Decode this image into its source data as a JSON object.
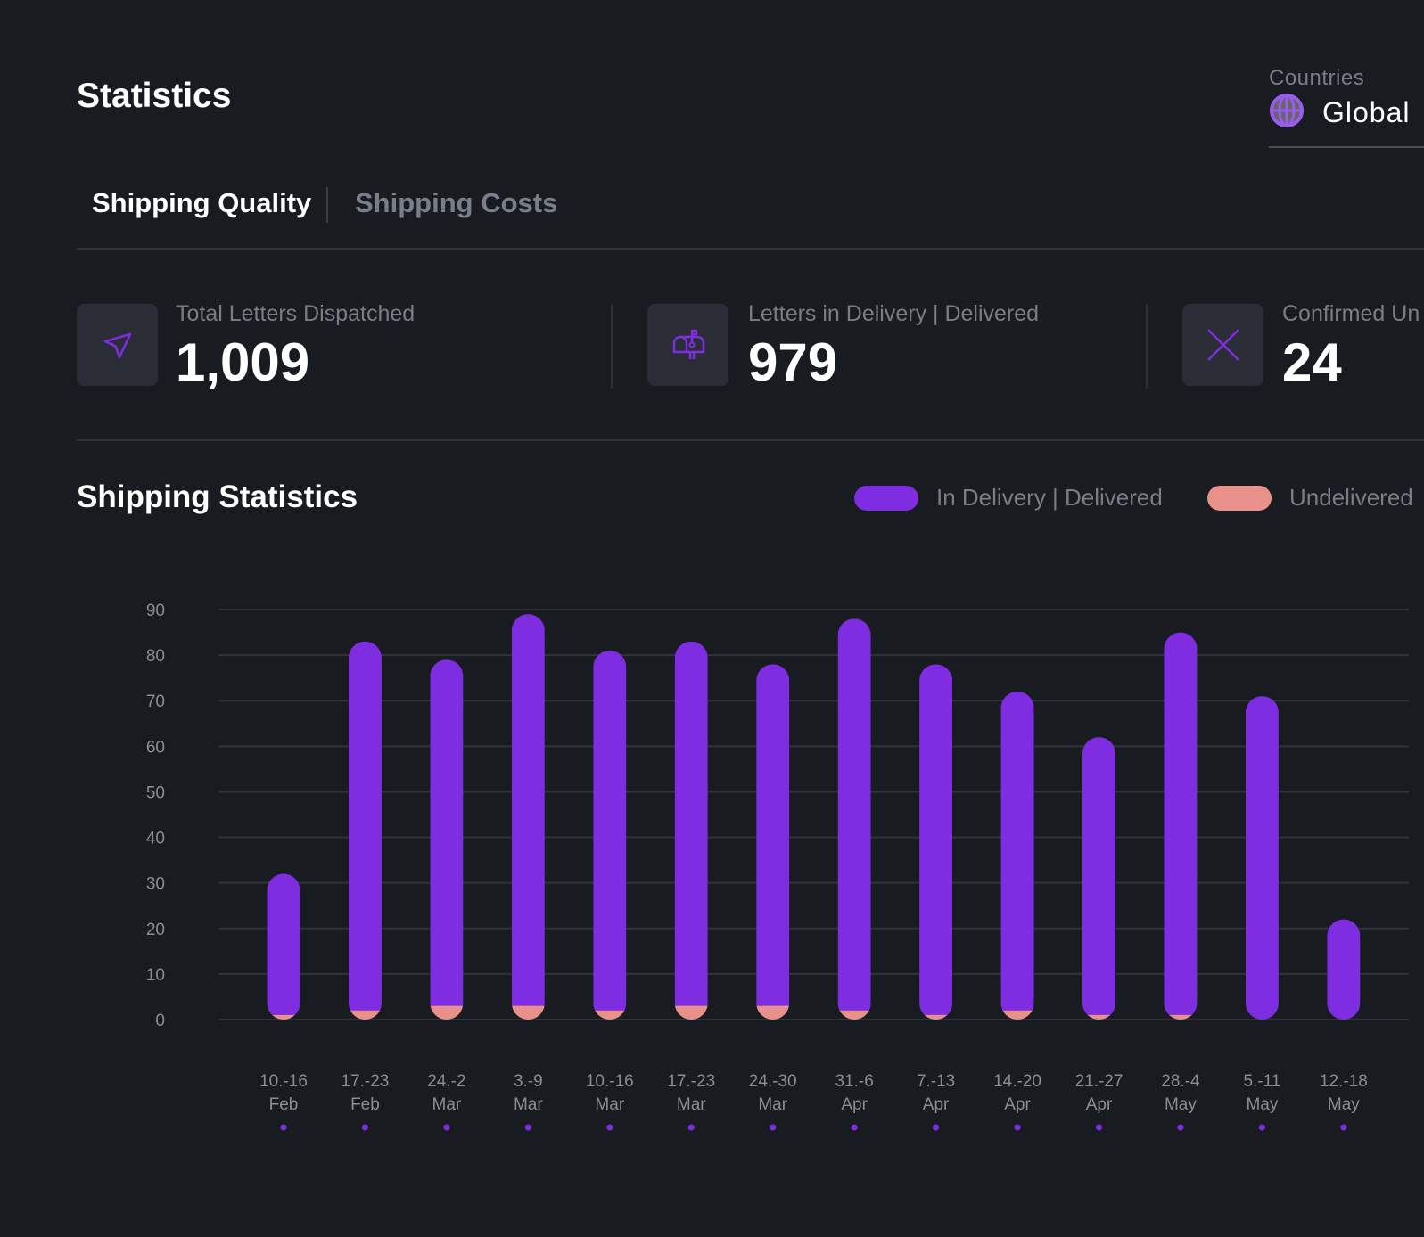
{
  "header": {
    "title": "Statistics"
  },
  "country_selector": {
    "label": "Countries",
    "value": "Global",
    "icon": "globe-icon"
  },
  "tabs": [
    {
      "label": "Shipping Quality",
      "active": true
    },
    {
      "label": "Shipping Costs",
      "active": false
    }
  ],
  "stats": [
    {
      "label": "Total Letters Dispatched",
      "value": "1,009",
      "icon": "paper-plane-icon"
    },
    {
      "label": "Letters in Delivery | Delivered",
      "value": "979",
      "icon": "mailbox-icon"
    },
    {
      "label": "Confirmed Un",
      "value": "24",
      "icon": "close-x-icon"
    }
  ],
  "section_title": "Shipping Statistics",
  "colors": {
    "accent": "#7e2de0",
    "undelivered": "#e8908a",
    "background": "#181b20"
  },
  "chart_data": {
    "type": "bar",
    "stacked": true,
    "categories": [
      [
        "10.-16",
        "Feb"
      ],
      [
        "17.-23",
        "Feb"
      ],
      [
        "24.-2",
        "Mar"
      ],
      [
        "3.-9",
        "Mar"
      ],
      [
        "10.-16",
        "Mar"
      ],
      [
        "17.-23",
        "Mar"
      ],
      [
        "24.-30",
        "Mar"
      ],
      [
        "31.-6",
        "Apr"
      ],
      [
        "7.-13",
        "Apr"
      ],
      [
        "14.-20",
        "Apr"
      ],
      [
        "21.-27",
        "Apr"
      ],
      [
        "28.-4",
        "May"
      ],
      [
        "5.-11",
        "May"
      ],
      [
        "12.-18",
        "May"
      ]
    ],
    "series": [
      {
        "name": "In Delivery | Delivered",
        "color": "#7e2de0",
        "values": [
          31,
          81,
          76,
          86,
          79,
          80,
          75,
          86,
          77,
          70,
          61,
          84,
          71,
          22
        ]
      },
      {
        "name": "Undelivered",
        "color": "#e8908a",
        "values": [
          1,
          2,
          3,
          3,
          2,
          3,
          3,
          2,
          1,
          2,
          1,
          1,
          0,
          0
        ]
      }
    ],
    "yticks": [
      0,
      10,
      20,
      30,
      40,
      50,
      60,
      70,
      80,
      90
    ],
    "ylim": [
      0,
      90
    ],
    "grid": true,
    "legend": "top-right"
  }
}
